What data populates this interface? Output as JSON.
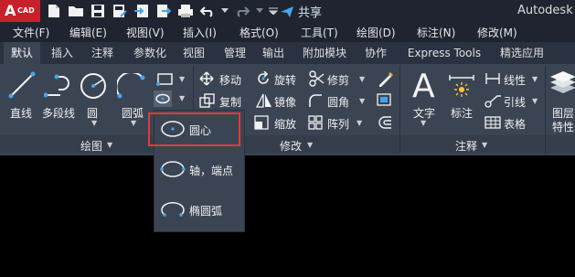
{
  "app": {
    "logo_a": "A",
    "logo_cad": "CAD",
    "title": "Autodesk A",
    "share_label": "共享"
  },
  "menu": [
    "文件(F)",
    "编辑(E)",
    "视图(V)",
    "插入(I)",
    "格式(O)",
    "工具(T)",
    "绘图(D)",
    "标注(N)",
    "修改(M)"
  ],
  "tabs": [
    "默认",
    "插入",
    "注释",
    "参数化",
    "视图",
    "管理",
    "输出",
    "附加模块",
    "协作",
    "Express Tools",
    "精选应用"
  ],
  "active_tab": "默认",
  "draw_panel": {
    "label": "绘图",
    "tools": [
      "直线",
      "多段线",
      "圆",
      "圆弧"
    ]
  },
  "modify_panel": {
    "label": "修改",
    "tools": [
      "移动",
      "旋转",
      "修剪",
      "复制",
      "镜像",
      "圆角",
      "缩放",
      "阵列"
    ]
  },
  "annotation_panel": {
    "label": "注释",
    "tools": [
      "文字",
      "标注",
      "线性",
      "引线",
      "表格"
    ]
  },
  "layer_panel": {
    "label_line1": "图层",
    "label_line2": "特性"
  },
  "ellipse_dropdown": {
    "items": [
      "圆心",
      "轴，端点",
      "椭圆弧"
    ],
    "highlighted": "圆心"
  },
  "colors": {
    "accent_red": "#e53935",
    "ribbon_bg": "#3b4453",
    "title_bg": "#1f2430",
    "share_blue": "#4aa3e8"
  }
}
